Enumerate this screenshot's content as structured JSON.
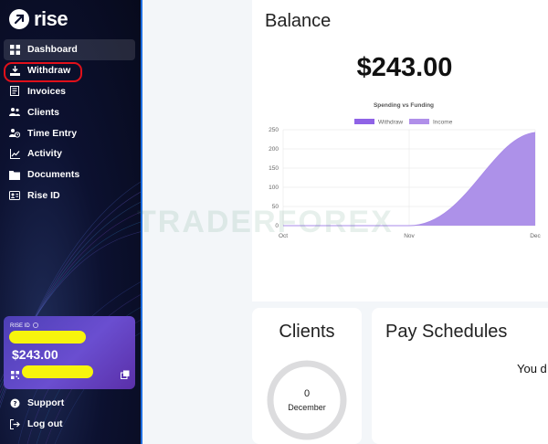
{
  "sidebar": {
    "logo_text": "rise",
    "nav": [
      {
        "label": "Dashboard",
        "icon": "dashboard-icon"
      },
      {
        "label": "Withdraw",
        "icon": "withdraw-icon"
      },
      {
        "label": "Invoices",
        "icon": "invoice-icon"
      },
      {
        "label": "Clients",
        "icon": "clients-icon"
      },
      {
        "label": "Time Entry",
        "icon": "time-entry-icon"
      },
      {
        "label": "Activity",
        "icon": "activity-icon"
      },
      {
        "label": "Documents",
        "icon": "documents-icon"
      },
      {
        "label": "Rise ID",
        "icon": "id-card-icon"
      }
    ],
    "card": {
      "label": "RISE ID",
      "amount": "$243.00"
    },
    "bottom_nav": [
      {
        "label": "Support",
        "icon": "support-icon"
      },
      {
        "label": "Log out",
        "icon": "logout-icon"
      }
    ]
  },
  "balance": {
    "title": "Balance",
    "amount": "$243.00"
  },
  "chart_data": {
    "type": "area",
    "title": "Spending vs Funding",
    "legend": [
      {
        "name": "Withdraw",
        "color": "#8f63e6"
      },
      {
        "name": "Income",
        "color": "#b08fe9"
      }
    ],
    "legend_position": "top",
    "categories": [
      "Oct",
      "Nov",
      "Dec"
    ],
    "y_ticks": [
      "250",
      "200",
      "150",
      "100",
      "50",
      "0"
    ],
    "ylim": [
      0,
      250
    ],
    "series": [
      {
        "name": "Income",
        "color": "#a98be8",
        "values": [
          0,
          0,
          243
        ]
      }
    ],
    "grid": true
  },
  "clients": {
    "title": "Clients",
    "count": "0",
    "period": "December"
  },
  "pay_schedules": {
    "title": "Pay Schedules",
    "text": "You d"
  },
  "watermark": "TRADERFOREX",
  "colors": {
    "sidebar_bg": "#0c1130",
    "accent": "#1f6fe0",
    "card_bg": "#5a45c8",
    "highlight": "#e0101a"
  }
}
